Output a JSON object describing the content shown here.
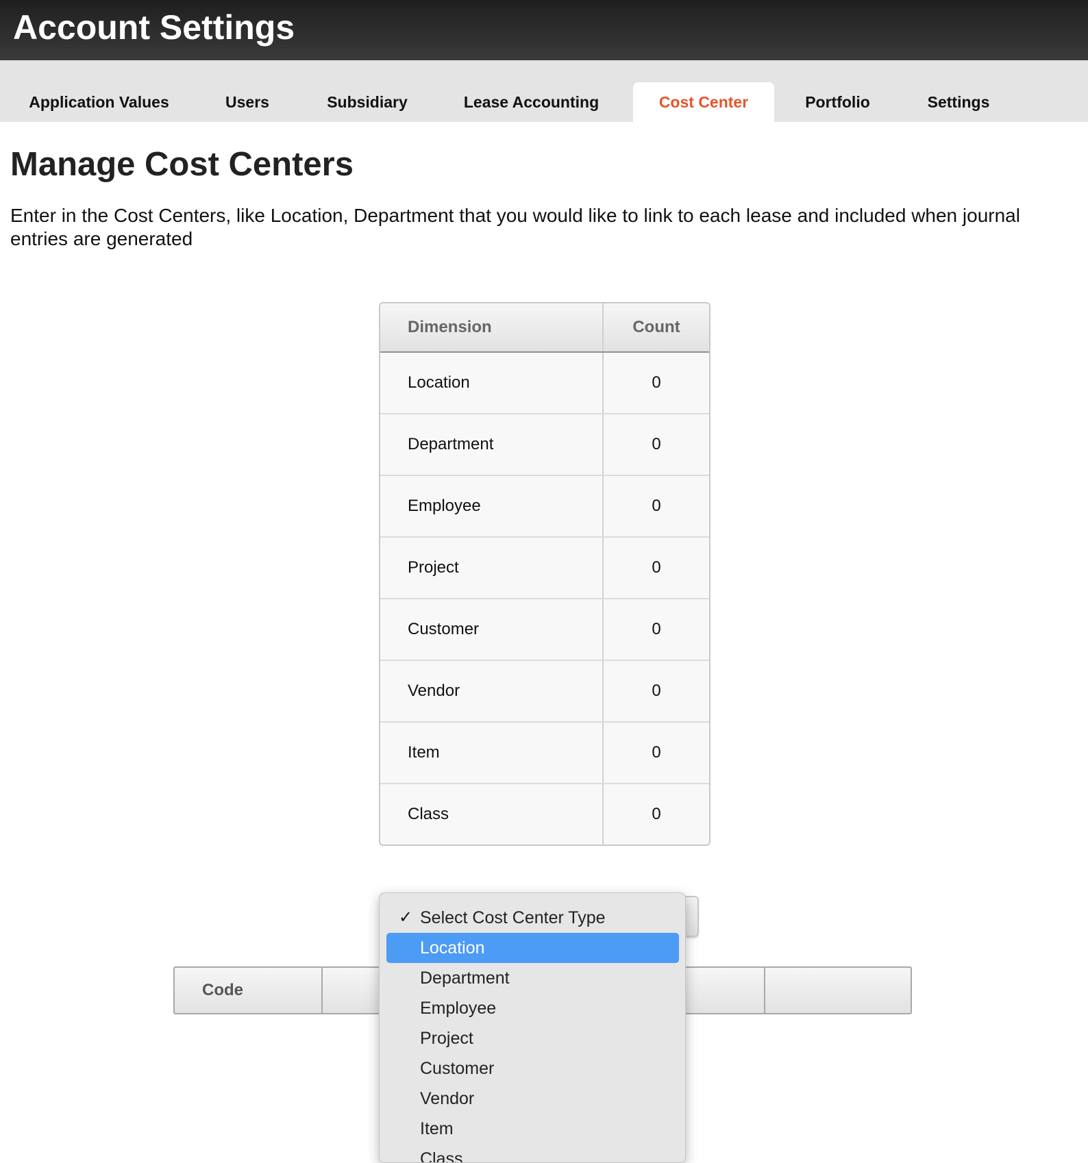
{
  "header": {
    "title": "Account Settings"
  },
  "tabs": [
    {
      "label": "Application Values",
      "active": false
    },
    {
      "label": "Users",
      "active": false
    },
    {
      "label": "Subsidiary",
      "active": false
    },
    {
      "label": "Lease Accounting",
      "active": false
    },
    {
      "label": "Cost Center",
      "active": true
    },
    {
      "label": "Portfolio",
      "active": false
    },
    {
      "label": "Settings",
      "active": false
    }
  ],
  "colors": {
    "active_tab_text": "#e8542a",
    "dropdown_highlight": "#4c9bf5",
    "header_bg": "#2b2b2b"
  },
  "main": {
    "title": "Manage Cost Centers",
    "description": "Enter in the Cost Centers, like Location, Department that you would like to link to each lease and included when journal entries are generated"
  },
  "dimension_table": {
    "headers": [
      "Dimension",
      "Count"
    ],
    "rows": [
      {
        "dimension": "Location",
        "count": "0"
      },
      {
        "dimension": "Department",
        "count": "0"
      },
      {
        "dimension": "Employee",
        "count": "0"
      },
      {
        "dimension": "Project",
        "count": "0"
      },
      {
        "dimension": "Customer",
        "count": "0"
      },
      {
        "dimension": "Vendor",
        "count": "0"
      },
      {
        "dimension": "Item",
        "count": "0"
      },
      {
        "dimension": "Class",
        "count": "0"
      }
    ]
  },
  "cost_center_select": {
    "selected": "Select Cost Center Type",
    "highlighted": "Location",
    "options": [
      "Select Cost Center Type",
      "Location",
      "Department",
      "Employee",
      "Project",
      "Customer",
      "Vendor",
      "Item",
      "Class"
    ]
  },
  "code_table": {
    "headers": [
      "Code",
      "",
      "",
      ""
    ]
  },
  "icons": {
    "selected_check": "checkmark-icon"
  }
}
